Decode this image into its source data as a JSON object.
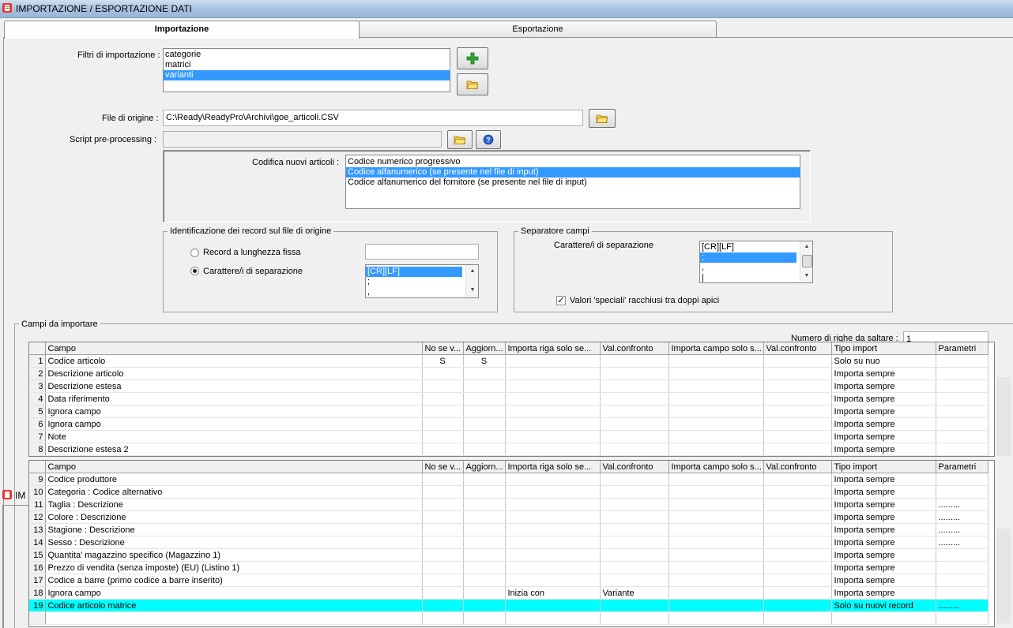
{
  "window": {
    "title": "IMPORTAZIONE / ESPORTAZIONE DATI"
  },
  "tabs": [
    {
      "label": "Importazione"
    },
    {
      "label": "Esportazione"
    }
  ],
  "filtri": {
    "label": "Filtri di importazione :",
    "items": [
      "categorie",
      "matrici",
      "varianti"
    ],
    "selected": 2
  },
  "file_origine": {
    "label": "File di origine :",
    "value": "C:\\Ready\\ReadyPro\\Archivi\\goe_articoli.CSV"
  },
  "script": {
    "label": "Script pre-processing :",
    "value": ""
  },
  "codifica": {
    "label": "Codifica nuovi articoli :",
    "items": [
      "Codice numerico progressivo",
      "Codice alfanumerico (se presente nel file di input)",
      "Codice alfanumerico del fornitore (se presente nel file di input)"
    ],
    "selected": 1
  },
  "identificazione": {
    "title": "Identificazione dei record sul file di origine",
    "opt1": "Record a lunghezza fissa",
    "opt2": "Carattere/i di separazione",
    "list": [
      "[CR][LF]",
      ";",
      ","
    ]
  },
  "separatore": {
    "title": "Separatore campi",
    "label": "Carattere/i di separazione",
    "list": [
      "[CR][LF]",
      ";",
      ",",
      "|"
    ],
    "checkbox": "Valori 'speciali' racchiusi tra doppi apici"
  },
  "campi": {
    "title": "Campi da importare",
    "skip_label": "Numero di righe da saltare :",
    "skip_value": "1"
  },
  "bg_window_title": "IM",
  "grid_headers": [
    "Campo",
    "No se v...",
    "Aggiorn...",
    "Importa riga solo se...",
    "Val.confronto",
    "Importa campo solo s...",
    "Val.confronto",
    "Tipo import",
    "Parametri"
  ],
  "grid1_rows": [
    {
      "n": "1",
      "campo": "Codice articolo",
      "nosev": "S",
      "agg": "S",
      "imprig": "",
      "val1": "",
      "impcam": "",
      "val2": "",
      "tipo": "Solo su nuo",
      "param": ""
    },
    {
      "n": "2",
      "campo": "Descrizione articolo",
      "nosev": "",
      "agg": "",
      "imprig": "",
      "val1": "",
      "impcam": "",
      "val2": "",
      "tipo": "Importa sempre",
      "param": ""
    },
    {
      "n": "3",
      "campo": "Descrizione estesa",
      "nosev": "",
      "agg": "",
      "imprig": "",
      "val1": "",
      "impcam": "",
      "val2": "",
      "tipo": "Importa sempre",
      "param": ""
    },
    {
      "n": "4",
      "campo": "Data riferimento",
      "nosev": "",
      "agg": "",
      "imprig": "",
      "val1": "",
      "impcam": "",
      "val2": "",
      "tipo": "Importa sempre",
      "param": ""
    },
    {
      "n": "5",
      "campo": "Ignora campo",
      "nosev": "",
      "agg": "",
      "imprig": "",
      "val1": "",
      "impcam": "",
      "val2": "",
      "tipo": "Importa sempre",
      "param": ""
    },
    {
      "n": "6",
      "campo": "Ignora campo",
      "nosev": "",
      "agg": "",
      "imprig": "",
      "val1": "",
      "impcam": "",
      "val2": "",
      "tipo": "Importa sempre",
      "param": ""
    },
    {
      "n": "7",
      "campo": "Note",
      "nosev": "",
      "agg": "",
      "imprig": "",
      "val1": "",
      "impcam": "",
      "val2": "",
      "tipo": "Importa sempre",
      "param": ""
    },
    {
      "n": "8",
      "campo": "Descrizione estesa 2",
      "nosev": "",
      "agg": "",
      "imprig": "",
      "val1": "",
      "impcam": "",
      "val2": "",
      "tipo": "Importa sempre",
      "param": ""
    }
  ],
  "grid2_rows": [
    {
      "n": "9",
      "campo": "Codice produttore",
      "nosev": "",
      "agg": "",
      "imprig": "",
      "val1": "",
      "impcam": "",
      "val2": "",
      "tipo": "Importa sempre",
      "param": ""
    },
    {
      "n": "10",
      "campo": "Categoria : Codice alternativo",
      "nosev": "",
      "agg": "",
      "imprig": "",
      "val1": "",
      "impcam": "",
      "val2": "",
      "tipo": "Importa sempre",
      "param": ""
    },
    {
      "n": "11",
      "campo": "Taglia : Descrizione",
      "nosev": "",
      "agg": "",
      "imprig": "",
      "val1": "",
      "impcam": "",
      "val2": "",
      "tipo": "Importa sempre",
      "param": "........."
    },
    {
      "n": "12",
      "campo": "Colore : Descrizione",
      "nosev": "",
      "agg": "",
      "imprig": "",
      "val1": "",
      "impcam": "",
      "val2": "",
      "tipo": "Importa sempre",
      "param": "........."
    },
    {
      "n": "13",
      "campo": "Stagione : Descrizione",
      "nosev": "",
      "agg": "",
      "imprig": "",
      "val1": "",
      "impcam": "",
      "val2": "",
      "tipo": "Importa sempre",
      "param": "........."
    },
    {
      "n": "14",
      "campo": "Sesso : Descrizione",
      "nosev": "",
      "agg": "",
      "imprig": "",
      "val1": "",
      "impcam": "",
      "val2": "",
      "tipo": "Importa sempre",
      "param": "........."
    },
    {
      "n": "15",
      "campo": "Quantita' magazzino specifico (Magazzino 1)",
      "nosev": "",
      "agg": "",
      "imprig": "",
      "val1": "",
      "impcam": "",
      "val2": "",
      "tipo": "Importa sempre",
      "param": ""
    },
    {
      "n": "16",
      "campo": "Prezzo di vendita (senza imposte) (EU) (Listino 1)",
      "nosev": "",
      "agg": "",
      "imprig": "",
      "val1": "",
      "impcam": "",
      "val2": "",
      "tipo": "Importa sempre",
      "param": ""
    },
    {
      "n": "17",
      "campo": "Codice a barre (primo codice a barre inserito)",
      "nosev": "",
      "agg": "",
      "imprig": "",
      "val1": "",
      "impcam": "",
      "val2": "",
      "tipo": "Importa sempre",
      "param": ""
    },
    {
      "n": "18",
      "campo": "Ignora campo",
      "nosev": "",
      "agg": "",
      "imprig": "Inizia con",
      "val1": "Variante",
      "impcam": "",
      "val2": "",
      "tipo": "Importa sempre",
      "param": ""
    },
    {
      "n": "19",
      "campo": "Codice articolo matrice",
      "nosev": "",
      "agg": "",
      "imprig": "",
      "val1": "",
      "impcam": "",
      "val2": "",
      "tipo": "Solo su nuovi record",
      "param": "........."
    },
    {
      "n": "",
      "campo": "",
      "nosev": "",
      "agg": "",
      "imprig": "",
      "val1": "",
      "impcam": "",
      "val2": "",
      "tipo": "",
      "param": ""
    }
  ],
  "highlight_row": 19,
  "colors": {
    "selection": "#3399ff",
    "row_highlight": "#00ffff"
  }
}
